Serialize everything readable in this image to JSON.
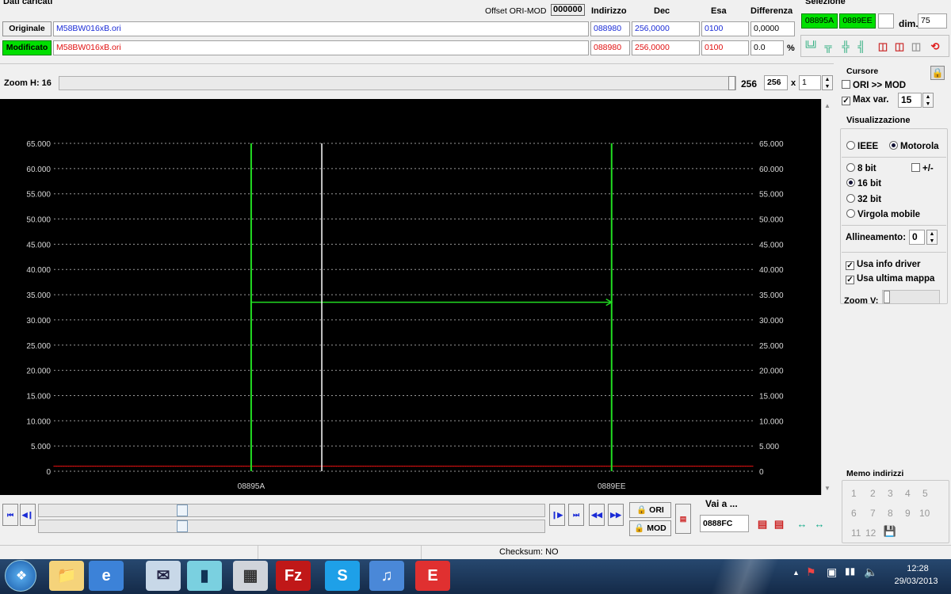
{
  "dati": {
    "title": "Dati caricati",
    "offset_label": "Offset ORI-MOD",
    "offset_value": "000000",
    "col_indirizzo": "Indirizzo",
    "col_dec": "Dec",
    "col_esa": "Esa",
    "col_differenza": "Differenza",
    "originale_label": "Originale",
    "originale_file": "M58BW016xB.ori",
    "originale_addr": "088980",
    "originale_dec": "256,0000",
    "originale_esa": "0100",
    "originale_diff": "0,0000",
    "modificato_label": "Modificato",
    "modificato_file": "M58BW016xB.ori",
    "modificato_addr": "088980",
    "modificato_dec": "256,0000",
    "modificato_esa": "0100",
    "modificato_diff": "0.0",
    "percent_symbol": "%"
  },
  "selezione": {
    "title": "Selezione",
    "start": "08895A",
    "end": "0889EE",
    "dim_label": "dim.",
    "dim_value": "75"
  },
  "zoom": {
    "label": "Zoom H: 16",
    "value1": "256",
    "value2": "256",
    "times": "x",
    "multiplier": "1"
  },
  "cursore": {
    "title": "Cursore",
    "ori_mod_label": "ORI >> MOD",
    "ori_mod_checked": false,
    "max_var_label": "Max var.",
    "max_var_checked": true,
    "max_var_value": "15"
  },
  "visualizzazione": {
    "title": "Visualizzazione",
    "ieee_label": "IEEE",
    "motorola_label": "Motorola",
    "byte_order": "motorola",
    "bit8_label": "8 bit",
    "bit16_label": "16 bit",
    "bit32_label": "32 bit",
    "float_label": "Virgola mobile",
    "selected_bits": "16 bit",
    "plusminus_label": "+/-",
    "plusminus_checked": false,
    "align_label": "Allineamento:",
    "align_value": "0",
    "usa_info_driver_label": "Usa info driver",
    "usa_info_driver_checked": true,
    "usa_ultima_mappa_label": "Usa ultima mappa",
    "usa_ultima_mappa_checked": true,
    "zoom_v_label": "Zoom V:"
  },
  "memo": {
    "title": "Memo indirizzi",
    "slots": [
      "1",
      "2",
      "3",
      "4",
      "5",
      "6",
      "7",
      "8",
      "9",
      "10",
      "11",
      "12"
    ]
  },
  "bottom": {
    "ori_label": "ORI",
    "mod_label": "MOD",
    "vai_label": "Vai a ...",
    "vai_value": "0888FC",
    "checksum": "Checksum: NO"
  },
  "taskbar": {
    "time": "12:28",
    "date": "29/03/2013"
  },
  "colors": {
    "accent_green": "#00e000",
    "plot_background": "#000000",
    "plot_line": "#e01010",
    "selection_marker": "#22dd22",
    "cursor_marker": "#ffffff"
  },
  "chart_data": {
    "type": "line",
    "ylim": [
      0,
      65000
    ],
    "yticks": [
      "0",
      "5.000",
      "10.000",
      "15.000",
      "20.000",
      "25.000",
      "30.000",
      "35.000",
      "40.000",
      "45.000",
      "50.000",
      "55.000",
      "60.000",
      "65.000"
    ],
    "x_labels": [
      "08895A",
      "0889EE"
    ],
    "selection": {
      "start": "08895A",
      "end": "0889EE",
      "arrow_level": 33500
    },
    "cursor_index": 10,
    "grid": true,
    "series": [
      {
        "values": [
          1000,
          1000,
          1000,
          1000,
          1000,
          1000,
          1000,
          1000,
          1000,
          1000,
          1000,
          1000,
          1000,
          1000,
          1000,
          1000,
          1000,
          1000,
          1000,
          1000,
          1000,
          1000,
          1000,
          1000,
          1000,
          1000,
          1000,
          1000,
          1000,
          1000,
          1000,
          1000,
          1000,
          1000,
          1000,
          1000,
          1000,
          1000,
          1000,
          1000,
          1000,
          1000,
          1000,
          1000,
          1000,
          1000,
          1000,
          1000,
          1000,
          1000,
          1000,
          1000,
          1000,
          1000,
          1000,
          1000,
          1000,
          1000,
          1000,
          1000,
          1000,
          1000,
          1000,
          1000,
          1000,
          1000,
          1000,
          1000,
          1000,
          1000,
          1000,
          1000,
          1000,
          1000,
          1000,
          1000,
          1000,
          1000,
          1000,
          1000,
          1000,
          1000,
          1000,
          1000,
          1000,
          1000,
          1000,
          1000,
          1000,
          1000,
          1000,
          1000,
          1000,
          1000,
          1000,
          1000,
          1000,
          1000,
          1000,
          1000,
          1000,
          1000,
          1000,
          1000,
          1000,
          1000,
          1000,
          1000,
          1000,
          1000,
          1000,
          1000,
          1000,
          1000,
          1000,
          1000,
          1000,
          1000,
          1000,
          1000,
          1000,
          1000,
          1000,
          1000,
          1000,
          1000,
          1000,
          1000,
          1000,
          1000,
          1000,
          1000,
          1000,
          1000,
          1000,
          1000,
          1000,
          1000,
          1000,
          1000,
          1000,
          1000,
          1000,
          1000,
          1000,
          1000,
          1000,
          1000,
          1000,
          1000,
          1000,
          1000,
          1000,
          1000,
          1000,
          1000,
          1000,
          1000,
          1000,
          1000,
          1000,
          1000,
          1000,
          1000,
          1000,
          1000,
          1000,
          1000,
          1000,
          1000,
          1000,
          1000,
          1000,
          1000,
          1000,
          1000,
          1000,
          1000,
          1000,
          1000,
          1000,
          1000,
          1000,
          1000,
          1000,
          1000,
          1000,
          1000,
          1000,
          1000,
          1000,
          1000,
          1000,
          1000,
          1000,
          1000,
          1000,
          1000,
          1000,
          1000,
          1000,
          1000,
          1000,
          1000,
          1000,
          1000,
          1000,
          1000,
          1000,
          1000,
          1000,
          1000,
          1000,
          1000,
          1000,
          1000,
          1000,
          1000,
          1000,
          1000,
          1000,
          1000,
          1000,
          1000,
          1000,
          1000,
          1000,
          1000,
          1000,
          1000,
          1000,
          1000,
          1000,
          1000,
          1000,
          1000,
          1000,
          1000,
          1000,
          1000,
          1000,
          1000,
          1000,
          1000,
          1000,
          1000,
          1000,
          1000,
          1000,
          1000,
          1000,
          1000,
          1000,
          1000,
          1000,
          1000,
          1000,
          1000,
          1000,
          1000,
          1000,
          1000,
          1000,
          1000,
          1000,
          1000,
          1000,
          1000,
          1000,
          1000,
          1000,
          1000,
          1000,
          1000,
          1000,
          1000,
          1000,
          1000,
          1000,
          1000,
          1000,
          1000,
          1000,
          1000,
          1000,
          1000,
          1000,
          1000
        ]
      }
    ]
  }
}
